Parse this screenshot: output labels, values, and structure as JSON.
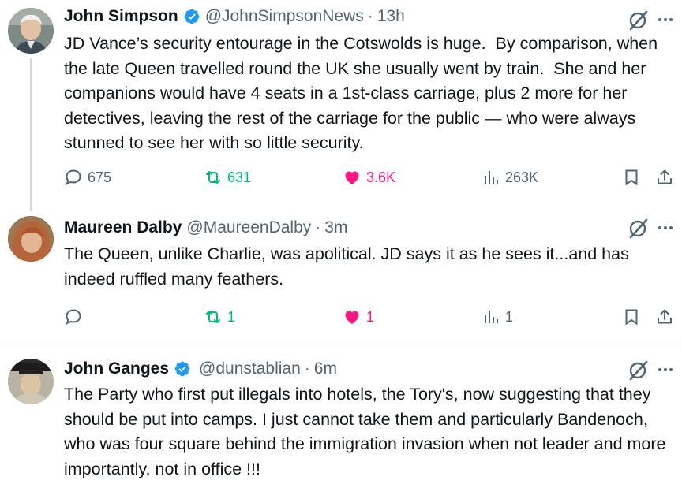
{
  "tweets": [
    {
      "name": "John Simpson",
      "verified": true,
      "handle": "@JohnSimpsonNews",
      "time": "13h",
      "text": "JD Vance’s security entourage in the Cotswolds is huge.  By comparison, when the late Queen travelled round the UK she usually went by train.  She and her companions would have 4 seats in a 1st-class carriage, plus 2 more for her detectives, leaving the rest of the carriage for the public — who were always stunned to see her with so little security.",
      "replies": "675",
      "reposts": "631",
      "likes": "3.6K",
      "views": "263K"
    },
    {
      "name": "Maureen Dalby",
      "verified": false,
      "handle": "@MaureenDalby",
      "time": "3m",
      "text": "The Queen, unlike Charlie, was apolitical. JD says it as he sees it...and has indeed ruffled many feathers.",
      "replies": "",
      "reposts": "1",
      "likes": "1",
      "views": "1"
    },
    {
      "name": "John Ganges",
      "verified": true,
      "handle": "@dunstablian",
      "time": "6m",
      "text": "The Party who first put illegals into hotels, the Tory's, now suggesting that they should be put into camps. I just cannot take them and particularly Bandenoch, who was four square behind the immigration invasion when not leader and more importantly, not in office !!!"
    }
  ],
  "colors": {
    "text": "#0f1419",
    "secondary": "#536471",
    "verified": "#1d9bf0",
    "repost": "#00ba7c",
    "like": "#f91880",
    "divider": "#eff3f4"
  },
  "icons": [
    "reply-icon",
    "repost-icon",
    "heart-icon",
    "views-icon",
    "bookmark-icon",
    "share-icon",
    "grok-icon",
    "more-icon",
    "verified-badge-icon"
  ]
}
